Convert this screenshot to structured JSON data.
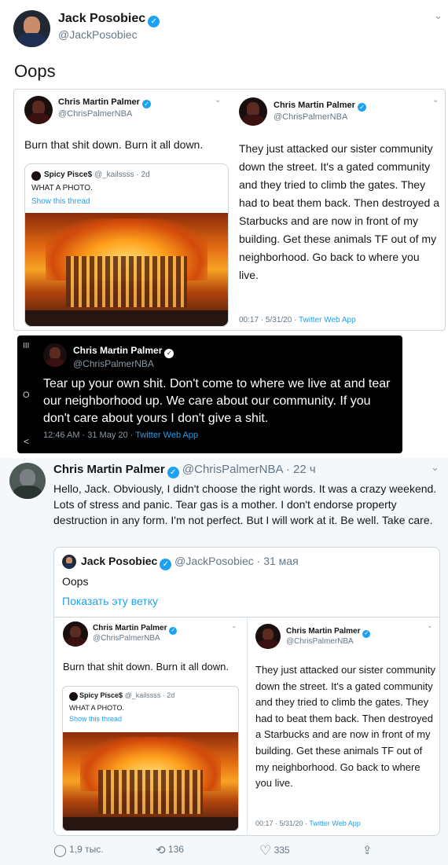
{
  "main_tweet": {
    "author_name": "Jack Posobiec",
    "author_handle": "@JackPosobiec",
    "text": "Oops"
  },
  "screenshot_left": {
    "author_name": "Chris Martin Palmer",
    "author_handle": "@ChrisPalmerNBA",
    "text": "Burn that shit down. Burn it all down.",
    "quoted": {
      "author_name": "Spicy Pisce$",
      "author_handle": "@_kailssss",
      "age": "· 2d",
      "text": "WHAT A PHOTO.",
      "show_thread": "Show this thread"
    }
  },
  "screenshot_right": {
    "author_name": "Chris Martin Palmer",
    "author_handle": "@ChrisPalmerNBA",
    "text": "They just attacked our sister community down the street. It's a gated community and they tried to climb the gates. They had to beat them back. Then destroyed a Starbucks and are now in front of my building. Get these animals TF out of my neighborhood. Go back to where you live.",
    "time": "00:17 · 5/31/20 ·",
    "source": "Twitter Web App"
  },
  "dark_tweet": {
    "author_name": "Chris Martin Palmer",
    "author_handle": "@ChrisPalmerNBA",
    "text": "Tear up your own shit. Don't come to where we live at and tear our neighborhood up. We care about our community. If you don't care about yours I don't give a shit.",
    "time": "12:46 AM · 31 May 20 ·",
    "source": "Twitter Web App",
    "side_menu": "III",
    "side_circle": "O",
    "side_back": "<"
  },
  "reply_tweet": {
    "author_name": "Chris Martin Palmer",
    "author_handle": "@ChrisPalmerNBA",
    "age": "· 22 ч",
    "text": "Hello, Jack. Obviously, I didn't choose the right words. It was a crazy weekend. Lots of stress and panic. Tear gas is a mother. I don't endorse property destruction in any form. I'm not perfect. But I will work at it. Be well. Take care.",
    "quote": {
      "author_name": "Jack Posobiec",
      "author_handle": "@JackPosobiec",
      "age": "· 31 мая",
      "text": "Oops",
      "show_thread": "Показать эту ветку"
    },
    "actions": {
      "replies": "1,9 тыс.",
      "retweets": "136",
      "likes": "335"
    }
  },
  "icons": {
    "verified": "✓",
    "chevron": "⌄",
    "reply": "◯",
    "retweet": "⟲",
    "like": "♡",
    "share": "⇪"
  }
}
